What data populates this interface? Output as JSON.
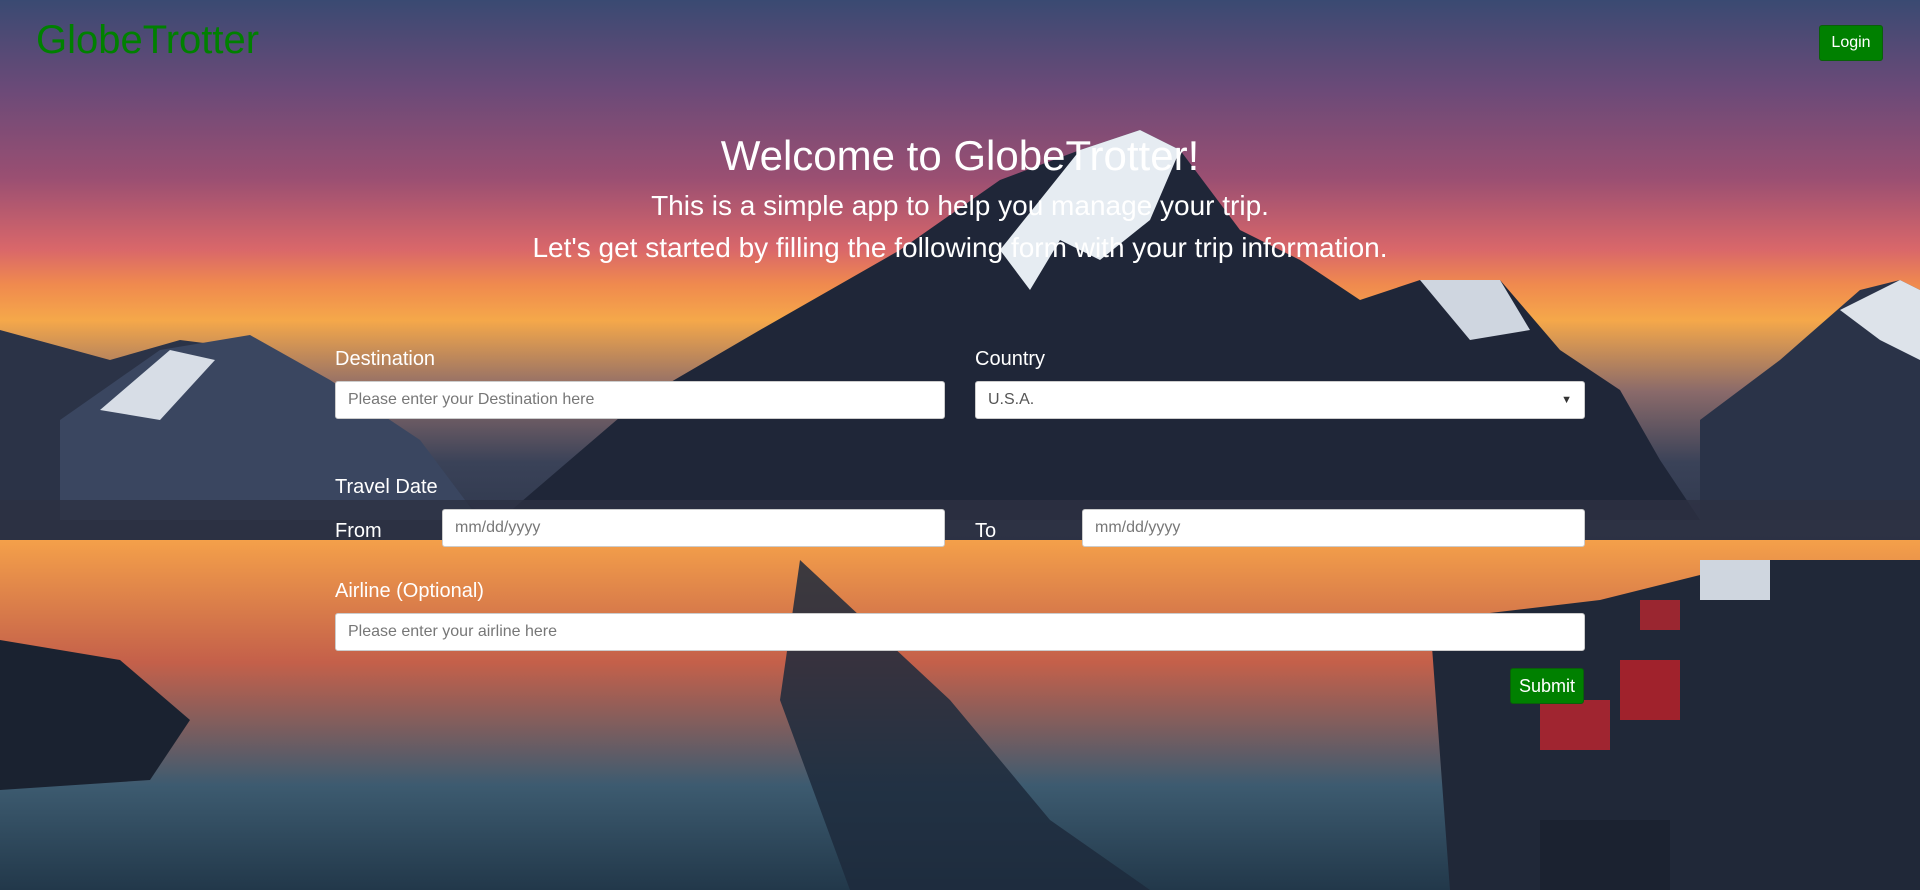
{
  "header": {
    "brand": "GlobeTrotter",
    "login_label": "Login"
  },
  "hero": {
    "title": "Welcome to GlobeTrotter!",
    "line1": "This is a simple app to help you manage your trip.",
    "line2": "Let's get started by filling the following form with your trip information."
  },
  "form": {
    "destination": {
      "label": "Destination",
      "placeholder": "Please enter your Destination here",
      "value": ""
    },
    "country": {
      "label": "Country",
      "selected": "U.S.A."
    },
    "travel_date": {
      "label": "Travel Date",
      "from_label": "From",
      "from_placeholder": "mm/dd/yyyy",
      "to_label": "To",
      "to_placeholder": "mm/dd/yyyy"
    },
    "airline": {
      "label": "Airline (Optional)",
      "placeholder": "Please enter your airline here",
      "value": ""
    },
    "submit_label": "Submit"
  },
  "colors": {
    "brand": "#008000",
    "button": "#008000",
    "text_on_background": "#ffffff"
  },
  "icons": {
    "country_dropdown": "chevron-down-icon"
  }
}
